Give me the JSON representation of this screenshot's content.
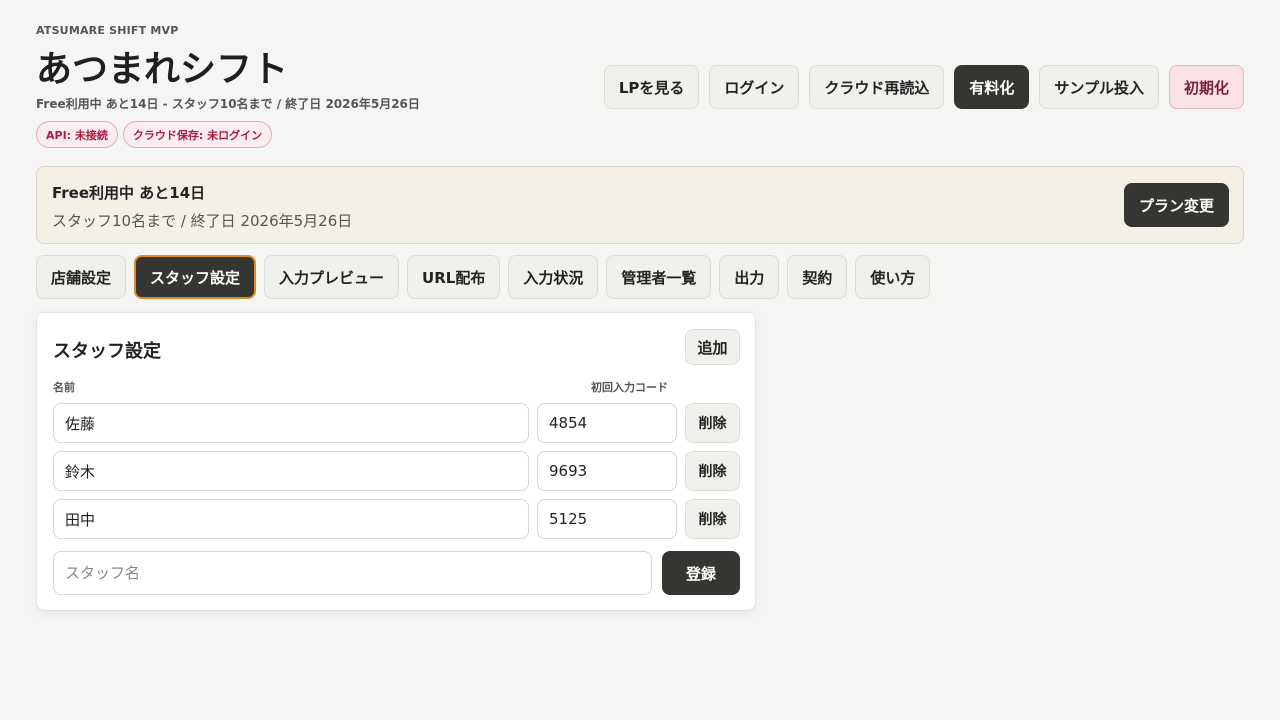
{
  "header": {
    "kicker": "ATSUMARE SHIFT MVP",
    "title": "あつまれシフト",
    "plan_summary": "Free利用中 あと14日 - スタッフ10名まで / 終了日 2026年5月26日",
    "badges": [
      {
        "label": "API: 未接続"
      },
      {
        "label": "クラウド保存: 未ログイン"
      }
    ],
    "actions": [
      {
        "label": "LPを見る"
      },
      {
        "label": "ログイン"
      },
      {
        "label": "クラウド再読込"
      },
      {
        "label": "有料化"
      },
      {
        "label": "サンプル投入"
      },
      {
        "label": "初期化"
      }
    ]
  },
  "plan_banner": {
    "title": "Free利用中 あと14日",
    "subtitle": "スタッフ10名まで / 終了日 2026年5月26日",
    "button_label": "プラン変更"
  },
  "tabs": [
    {
      "label": "店舗設定"
    },
    {
      "label": "スタッフ設定"
    },
    {
      "label": "入力プレビュー"
    },
    {
      "label": "URL配布"
    },
    {
      "label": "入力状況"
    },
    {
      "label": "管理者一覧"
    },
    {
      "label": "出力"
    },
    {
      "label": "契約"
    },
    {
      "label": "使い方"
    }
  ],
  "active_tab": "スタッフ設定",
  "staff_panel": {
    "title": "スタッフ設定",
    "add_label": "追加",
    "columns": {
      "name": "名前",
      "code": "初回入力コード"
    },
    "rows": [
      {
        "name": "佐藤",
        "code": "4854",
        "delete_label": "削除"
      },
      {
        "name": "鈴木",
        "code": "9693",
        "delete_label": "削除"
      },
      {
        "name": "田中",
        "code": "5125",
        "delete_label": "削除"
      }
    ],
    "new_staff_placeholder": "スタッフ名",
    "register_label": "登録"
  },
  "colors": {
    "background": "#f5f5f3",
    "dark_button": "#353632",
    "active_tab_border": "#e08a28",
    "banner_background": "#f5f0e5",
    "badge_text": "#a8203f",
    "danger_text": "#7d1f33"
  }
}
